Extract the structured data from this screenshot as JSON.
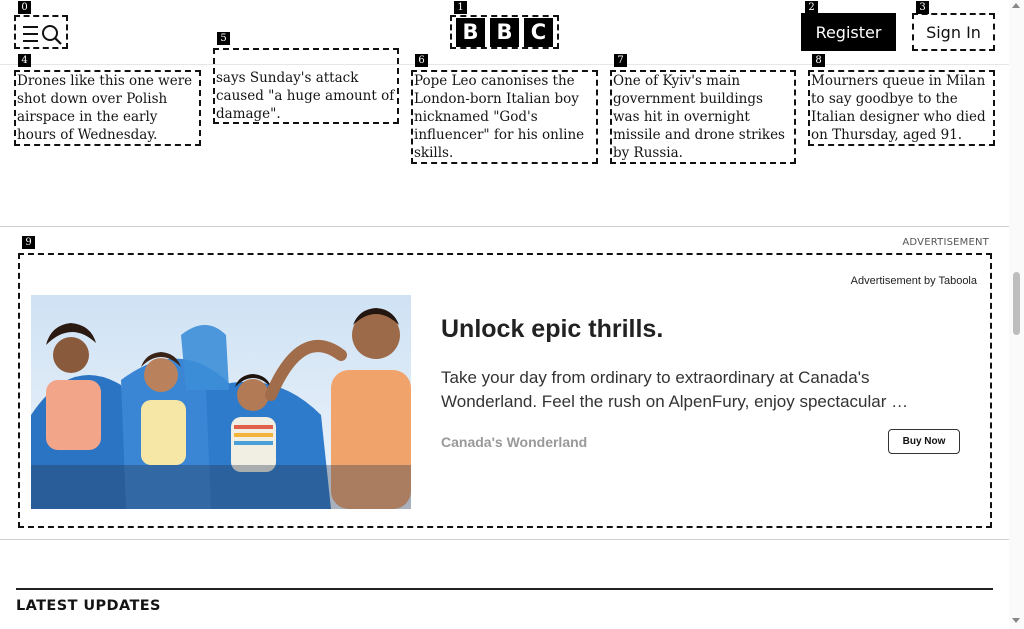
{
  "header": {
    "logo_letters": [
      "B",
      "B",
      "C"
    ],
    "register_label": "Register",
    "signin_label": "Sign In"
  },
  "labels": [
    "0",
    "1",
    "2",
    "3",
    "4",
    "5",
    "6",
    "7",
    "8",
    "9"
  ],
  "stories": [
    {
      "text": "Drones like this one were shot down over Polish airspace in the early hours of Wednesday."
    },
    {
      "text": "says Sunday's attack caused \"a huge amount of damage\"."
    },
    {
      "text": "Pope Leo canonises the London-born Italian boy nicknamed \"God's influencer\" for his online skills."
    },
    {
      "text": "One of Kyiv's main government buildings was hit in overnight missile and drone strikes by Russia."
    },
    {
      "text": "Mourners queue in Milan to say goodbye to the Italian designer who died on Thursday, aged 91."
    }
  ],
  "ad": {
    "label": "ADVERTISEMENT",
    "by": "Advertisement by Taboola",
    "title": "Unlock epic thrills.",
    "description": "Take your day from ordinary to extraordinary at Canada's Wonderland. Feel the rush on AlpenFury, enjoy spectacular …",
    "brand": "Canada's Wonderland",
    "cta": "Buy Now"
  },
  "section": {
    "latest_title": "LATEST UPDATES"
  },
  "icons": {
    "menu": "menu-icon",
    "search": "search-icon"
  }
}
